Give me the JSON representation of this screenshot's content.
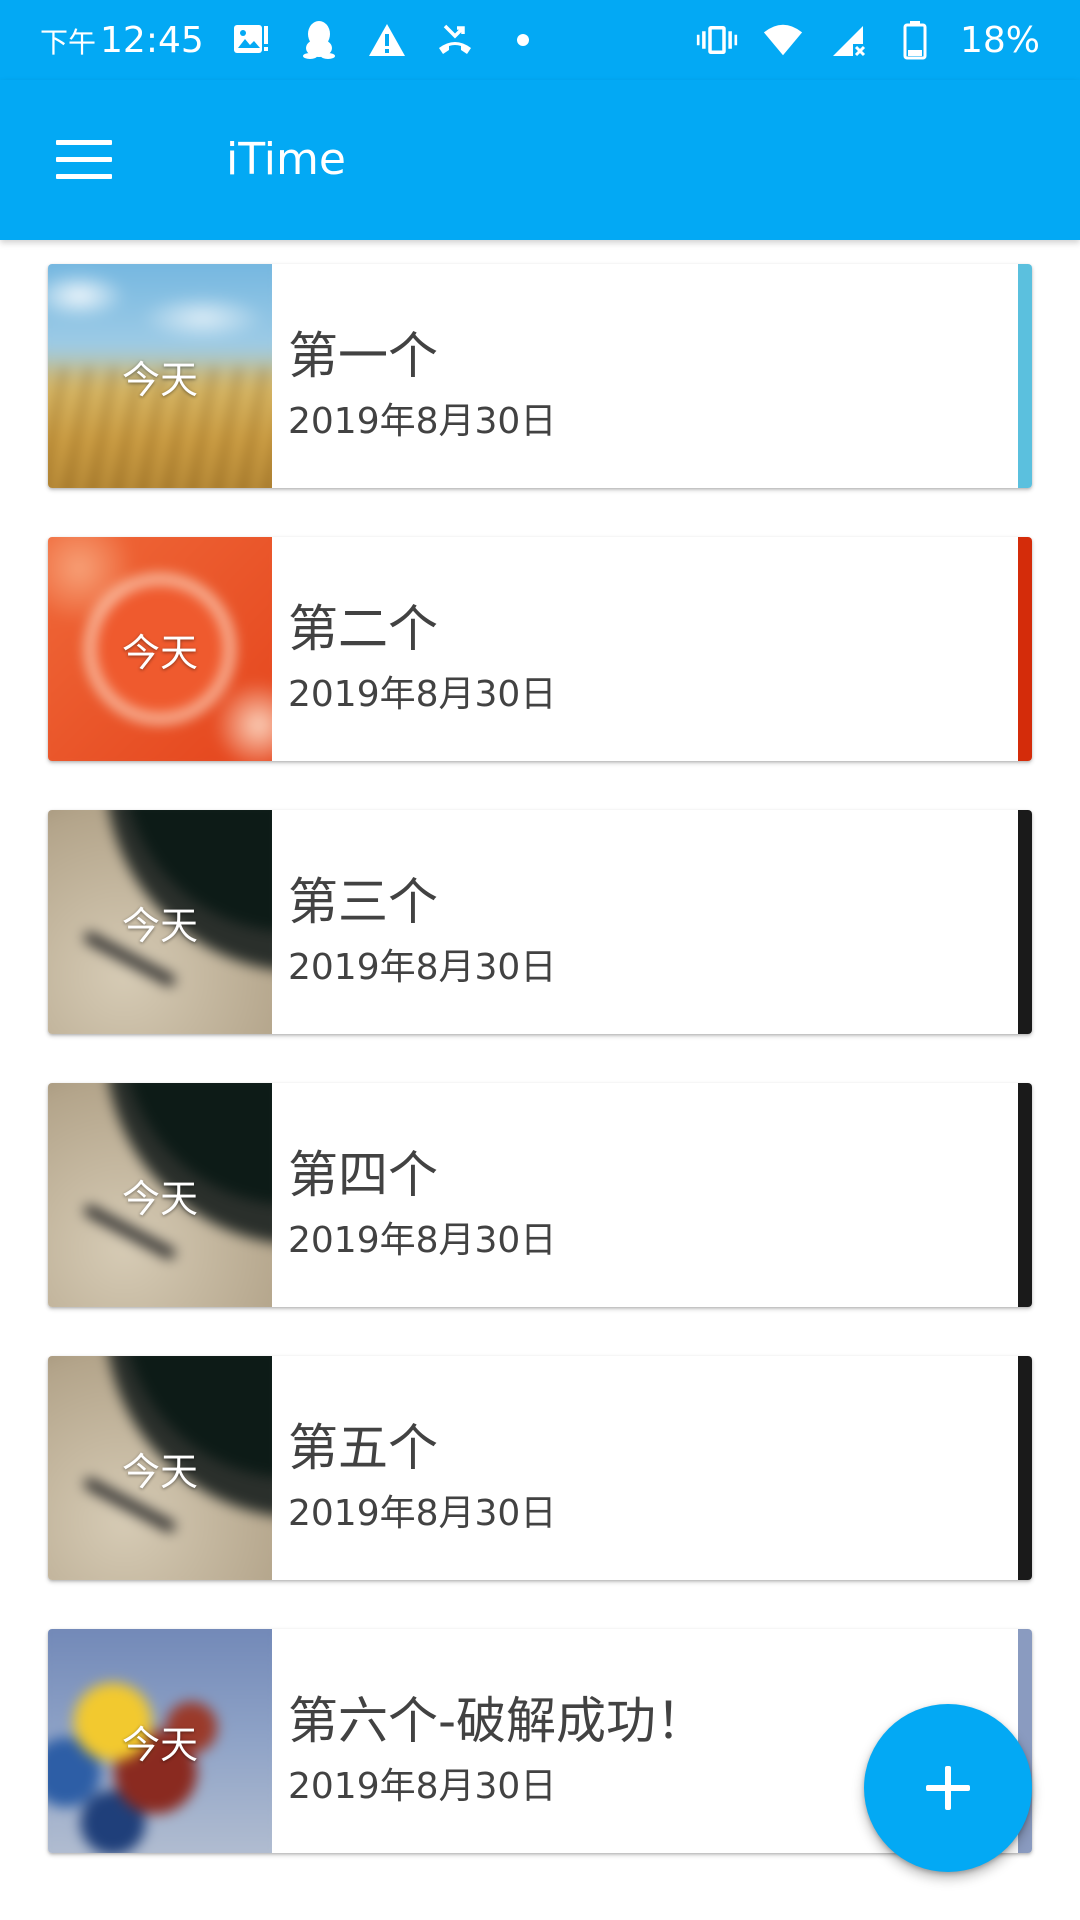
{
  "status_bar": {
    "ampm": "下午",
    "time": "12:45",
    "battery": "18%",
    "left_icons": [
      "image-alert-icon",
      "qq-icon",
      "warning-icon",
      "missed-call-icon",
      "dot-icon"
    ],
    "right_icons": [
      "vibrate-icon",
      "wifi-icon",
      "cell-signal-icon",
      "battery-icon"
    ]
  },
  "app_bar": {
    "title": "iTime",
    "menu_icon": "hamburger-menu-icon",
    "background": "#03A9F4"
  },
  "items": [
    {
      "thumb_label": "今天",
      "title": "第一个",
      "date": "2019年8月30日",
      "accent": "#5BC0DE",
      "image": "wheat-field"
    },
    {
      "thumb_label": "今天",
      "title": "第二个",
      "date": "2019年8月30日",
      "accent": "#D42C0A",
      "image": "orange-slice"
    },
    {
      "thumb_label": "今天",
      "title": "第三个",
      "date": "2019年8月30日",
      "accent": "#1A1A1A",
      "image": "clock"
    },
    {
      "thumb_label": "今天",
      "title": "第四个",
      "date": "2019年8月30日",
      "accent": "#1A1A1A",
      "image": "clock"
    },
    {
      "thumb_label": "今天",
      "title": "第五个",
      "date": "2019年8月30日",
      "accent": "#1A1A1A",
      "image": "clock"
    },
    {
      "thumb_label": "今天",
      "title": "第六个-破解成功！",
      "date": "2019年8月30日",
      "accent": "#8A9BC0",
      "image": "balloons"
    }
  ],
  "fab": {
    "icon": "plus-icon",
    "color": "#03A9F4"
  }
}
